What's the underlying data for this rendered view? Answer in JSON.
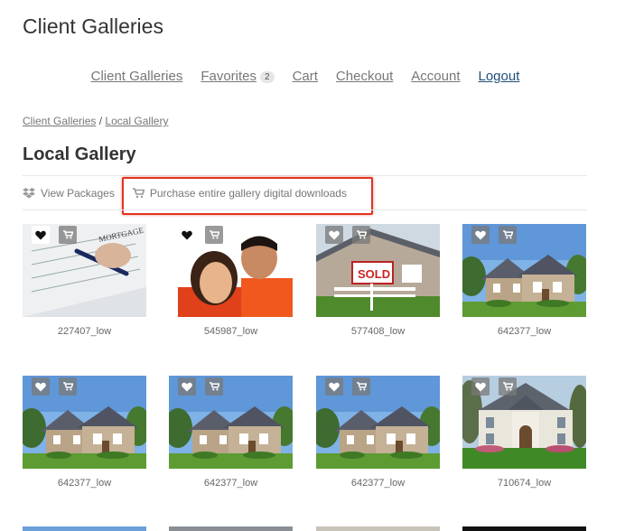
{
  "site": {
    "title": "Client Galleries"
  },
  "nav": {
    "items": [
      {
        "label": "Client Galleries"
      },
      {
        "label": "Favorites",
        "badge": "2"
      },
      {
        "label": "Cart"
      },
      {
        "label": "Checkout"
      },
      {
        "label": "Account"
      },
      {
        "label": "Logout"
      }
    ]
  },
  "breadcrumb": {
    "root": "Client Galleries",
    "sep": "/",
    "current": "Local Gallery"
  },
  "page": {
    "title": "Local Gallery"
  },
  "actions": {
    "view_packages": "View Packages",
    "purchase_all": "Purchase entire gallery digital downloads"
  },
  "gallery": {
    "items": [
      {
        "caption": "227407_low",
        "image": "mortgage-document"
      },
      {
        "caption": "545987_low",
        "image": "smiling-couple"
      },
      {
        "caption": "577408_low",
        "image": "sold-sign-house"
      },
      {
        "caption": "642377_low",
        "image": "suburban-house"
      },
      {
        "caption": "642377_low",
        "image": "suburban-house"
      },
      {
        "caption": "642377_low",
        "image": "suburban-house"
      },
      {
        "caption": "642377_low",
        "image": "suburban-house"
      },
      {
        "caption": "710674_low",
        "image": "white-mansion"
      }
    ]
  },
  "colors": {
    "highlight": "#e0331e",
    "logout_link": "#1f4e7a"
  }
}
